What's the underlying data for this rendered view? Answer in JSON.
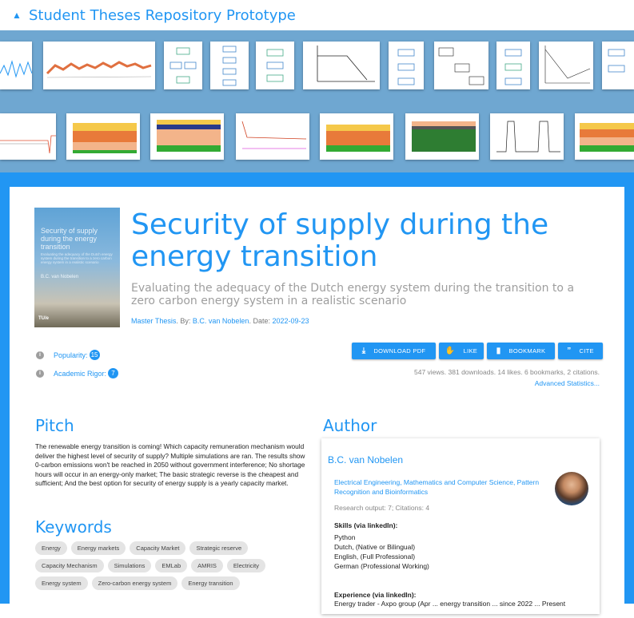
{
  "app": {
    "title": "Student Theses Repository Prototype",
    "logo_icon": "graduation-cap-icon"
  },
  "thesis": {
    "title": "Security of supply during the energy transition",
    "subtitle": "Evaluating the adequacy of the Dutch energy system during the transition to a zero carbon energy system in a realistic scenario",
    "type": "Master Thesis",
    "by_label": ". By:",
    "author": "B.C. van Nobelen",
    "date_label": ". Date:",
    "date": "2022-09-23",
    "cover": {
      "title": "Security of supply during the energy transition",
      "subtitle": "Evaluating the adequacy of the Dutch energy system during the transition to a zero carbon energy system in a realistic scenario",
      "author": "B.C. van Nobelen",
      "logo": "TU/e"
    }
  },
  "scores": {
    "popularity_label": "Popularity:",
    "popularity": "15",
    "rigor_label": "Academic Rigor:",
    "rigor": "7"
  },
  "actions": {
    "download": "DOWNLOAD PDF",
    "like": "LIKE",
    "bookmark": "BOOKMARK",
    "cite": "CITE"
  },
  "stats": {
    "line": "547 views. 381 downloads. 14 likes. 6 bookmarks, 2 citations.",
    "advanced": "Advanced Statistics..."
  },
  "pitch": {
    "heading": "Pitch",
    "text": "The renewable energy transition is coming! Which capacity remuneration mechanism would deliver the highest level of security of supply? Multiple simulations are ran. The results show 0-carbon emissions won't be reached in 2050 without government interference; No shortage hours will occur in an energy-only market; The basic strategic reverse is the cheapest and sufficient; And the best option for security of energy supply is a yearly capacity market."
  },
  "keywords": {
    "heading": "Keywords",
    "items": [
      "Energy",
      "Energy markets",
      "Capacity Market",
      "Strategic reserve",
      "Capacity Mechanism",
      "Simulations",
      "EMLab",
      "AMRIS",
      "Electricity",
      "Energy system",
      "Zero-carbon energy system",
      "Energy transition"
    ]
  },
  "author": {
    "heading": "Author",
    "name": "B.C. van Nobelen",
    "department": "Electrical Engineering, Mathematics and Computer Science, Pattern Recognition and Bioinformatics",
    "research": "Research output: 7; Citations: 4",
    "skills_heading": "Skills (via linkedIn):",
    "skills": [
      "Python",
      "Dutch, (Native or Bilingual)",
      "English, (Full Professional)",
      "German (Professional Working)"
    ],
    "experience_heading": "Experience (via linkedIn):",
    "experience": "Energy trader - Axpo group (Apr ... energy transition ... since 2022 ... Present"
  },
  "colors": {
    "accent": "#2196f3",
    "gallery_bg": "#6fa7d1"
  }
}
